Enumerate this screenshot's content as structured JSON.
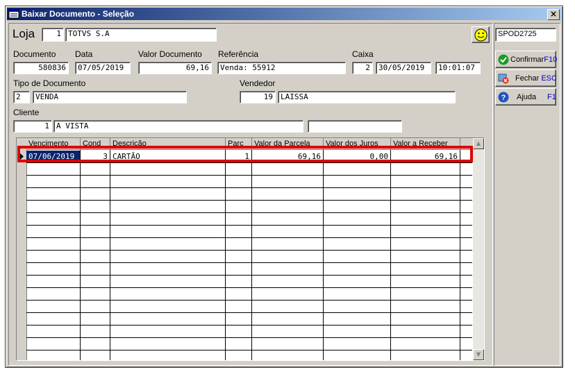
{
  "window": {
    "title": "Baixar Documento - Seleção",
    "close_glyph": "×"
  },
  "loja": {
    "label": "Loja",
    "code": "1",
    "name": "TOTVS S.A"
  },
  "station": "SPOD2725",
  "labels": {
    "documento": "Documento",
    "data": "Data",
    "valor_documento": "Valor Documento",
    "referencia": "Referência",
    "caixa": "Caixa",
    "tipo_documento": "Tipo de Documento",
    "vendedor": "Vendedor",
    "cliente": "Cliente"
  },
  "fields": {
    "documento": "580836",
    "data": "07/05/2019",
    "valor_documento": "69,16",
    "referencia": "Venda: 55912",
    "caixa_num": "2",
    "caixa_data": "30/05/2019",
    "caixa_hora": "10:01:07",
    "tipo_code": "2",
    "tipo_name": "VENDA",
    "vendedor_code": "19",
    "vendedor_name": "LAISSA",
    "cliente_code": "1",
    "cliente_name": "A VISTA",
    "cliente_extra": ""
  },
  "buttons": {
    "confirmar": {
      "label": "Confirmar",
      "key": "F10",
      "icon": "check-icon"
    },
    "fechar": {
      "label": "Fechar",
      "key": "ESC",
      "icon": "close-icon"
    },
    "ajuda": {
      "label": "Ajuda",
      "key": "F1",
      "icon": "help-icon"
    }
  },
  "table": {
    "columns": [
      "Vencimento",
      "Cond",
      "Descrição",
      "Parc",
      "Valor da Parcela",
      "Valor dos Juros",
      "Valor a Receber"
    ],
    "rows": [
      {
        "vencimento": "07/06/2019",
        "cond": "3",
        "descricao": "CARTÃO",
        "parc": "1",
        "valor_parcela": "69,16",
        "valor_juros": "0,00",
        "valor_receber": "69,16"
      }
    ]
  },
  "colors": {
    "title_start": "#0a246a",
    "title_end": "#a6caf0",
    "highlight": "#e00000",
    "selection": "#0a246a"
  }
}
